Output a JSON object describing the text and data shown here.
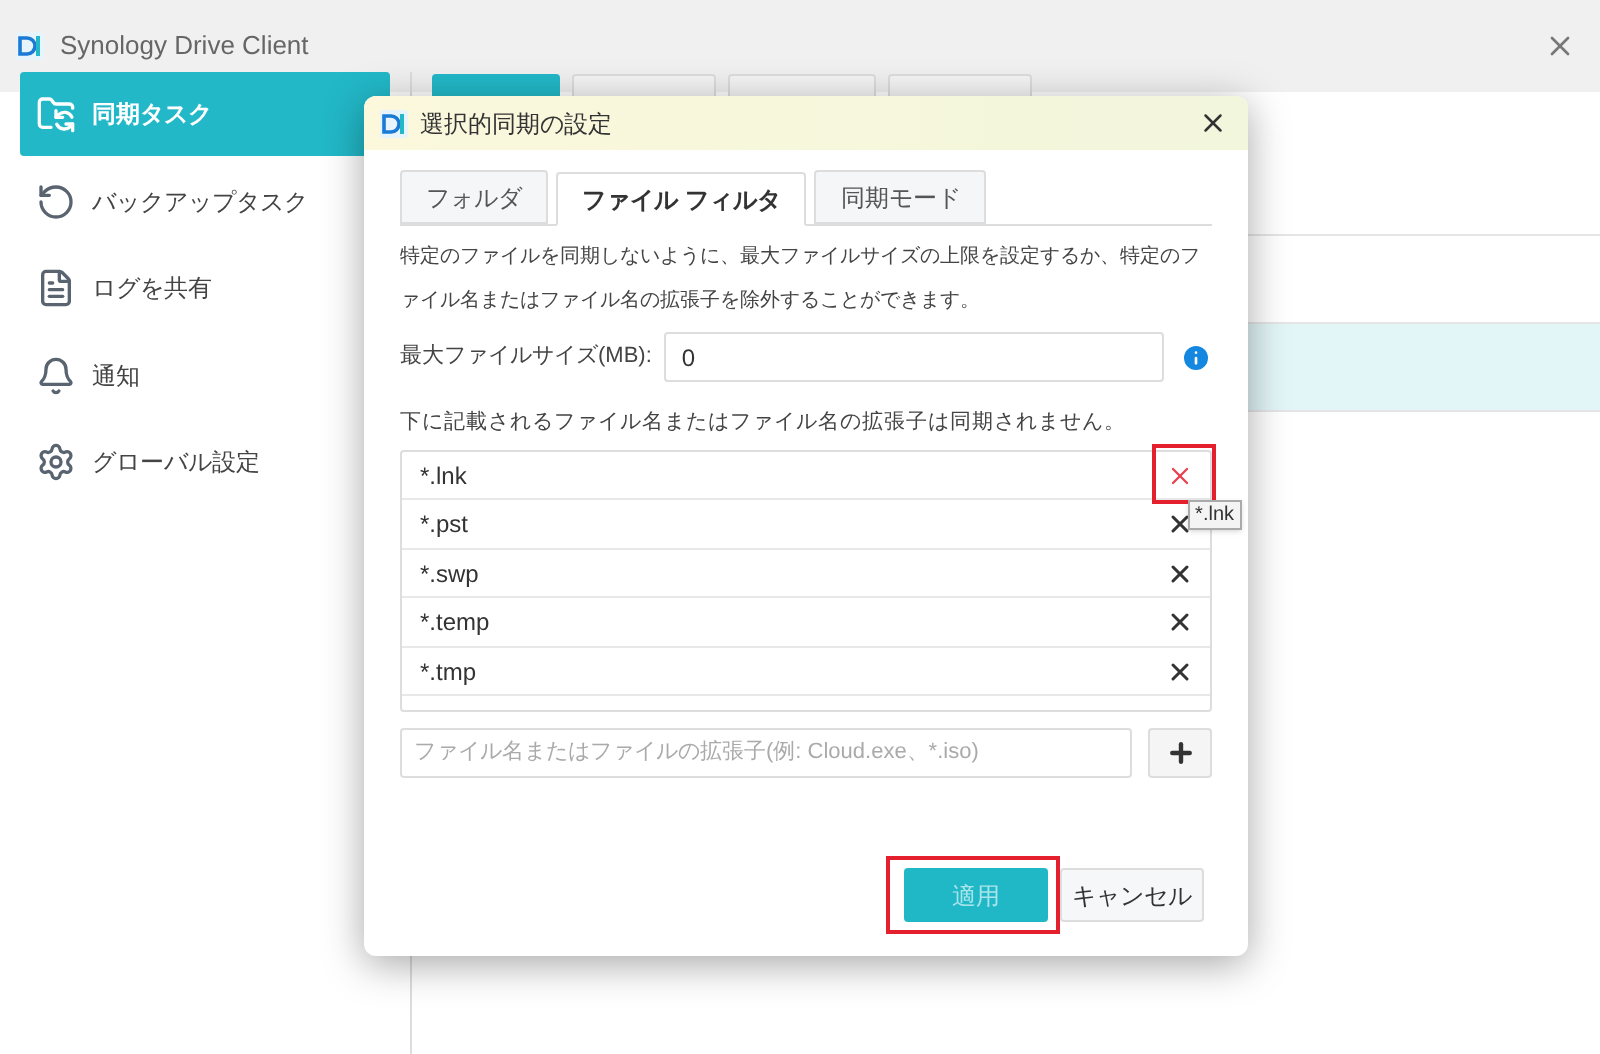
{
  "window": {
    "title": "Synology Drive Client"
  },
  "sidebar": {
    "items": [
      {
        "label": "同期タスク",
        "selected": true
      },
      {
        "label": "バックアップタスク",
        "selected": false
      },
      {
        "label": "ログを共有",
        "selected": false
      },
      {
        "label": "通知",
        "selected": false
      },
      {
        "label": "グローバル設定",
        "selected": false
      }
    ]
  },
  "task_list": {
    "rows": [
      {
        "selected": false
      },
      {
        "selected": false
      },
      {
        "selected": true
      }
    ]
  },
  "dialog": {
    "title": "選択的同期の設定",
    "tabs": [
      {
        "label": "フォルダ",
        "selected": false
      },
      {
        "label": "ファイル フィルタ",
        "selected": true
      },
      {
        "label": "同期モード",
        "selected": false
      }
    ],
    "description": "特定のファイルを同期しないように、最大ファイルサイズの上限を設定するか、特定のファイル名またはファイル名の拡張子を除外することができます。",
    "max_size": {
      "label": "最大ファイルサイズ(MB):",
      "value": "0"
    },
    "list_label": "下に記載されるファイル名またはファイル名の拡張子は同期されません。",
    "excluded": [
      {
        "pattern": "*.lnk",
        "hovered": true,
        "annotated": true
      },
      {
        "pattern": "*.pst",
        "hovered": false,
        "annotated": false
      },
      {
        "pattern": "*.swp",
        "hovered": false,
        "annotated": false
      },
      {
        "pattern": "*.temp",
        "hovered": false,
        "annotated": false
      },
      {
        "pattern": "*.tmp",
        "hovered": false,
        "annotated": false
      }
    ],
    "tooltip": "*.lnk",
    "add_field": {
      "placeholder": "ファイル名またはファイルの拡張子(例: Cloud.exe、*.iso)"
    },
    "buttons": [
      {
        "label": "適用",
        "kind": "primary",
        "annotated": true
      },
      {
        "label": "キャンセル",
        "kind": "secondary",
        "annotated": false
      }
    ]
  }
}
